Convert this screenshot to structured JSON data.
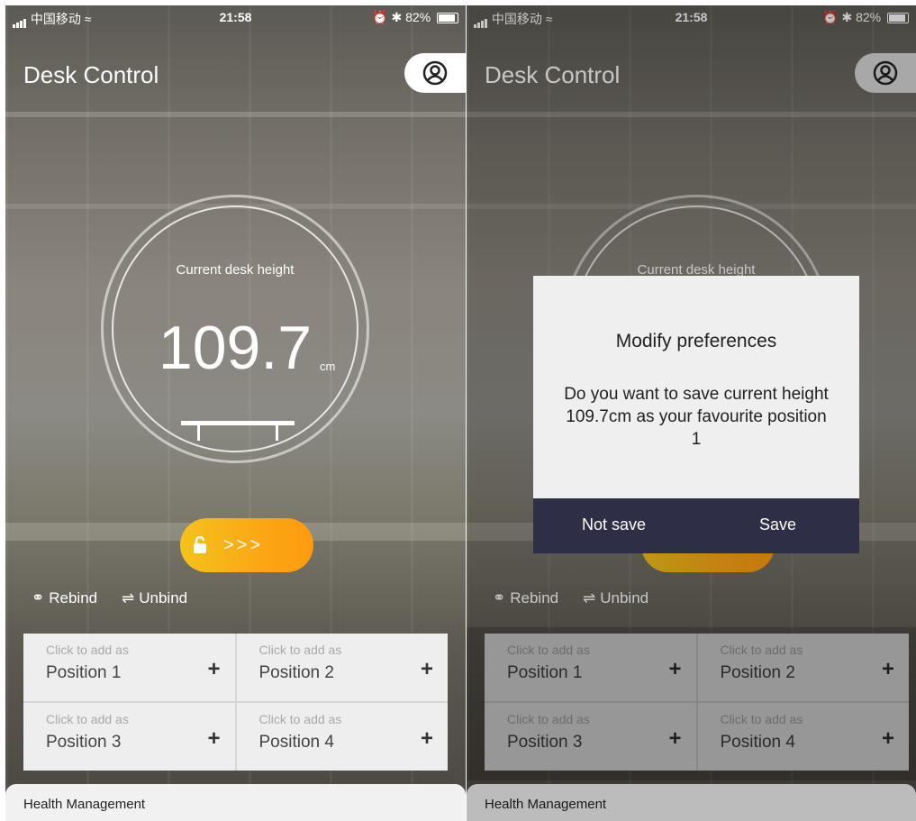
{
  "status": {
    "carrier": "中国移动",
    "time": "21:58",
    "battery": "82%"
  },
  "app": {
    "title": "Desk Control"
  },
  "gauge": {
    "label": "Current desk height",
    "value": "109.7",
    "unit": "cm"
  },
  "unlock": {
    "arrows": ">>>"
  },
  "binding": {
    "rebind": "Rebind",
    "unbind": "Unbind"
  },
  "positions": [
    {
      "hint": "Click to add as",
      "name": "Position 1",
      "plus": "+"
    },
    {
      "hint": "Click to add as",
      "name": "Position 2",
      "plus": "+"
    },
    {
      "hint": "Click to add as",
      "name": "Position 3",
      "plus": "+"
    },
    {
      "hint": "Click to add as",
      "name": "Position 4",
      "plus": "+"
    }
  ],
  "health": {
    "label": "Health Management"
  },
  "dialog": {
    "title": "Modify preferences",
    "message": "Do you want to save current height 109.7cm as your favourite position 1",
    "not_save": "Not save",
    "save": "Save"
  },
  "colors": {
    "accent_start": "#f4c21a",
    "accent_end": "#fe9b0e",
    "dialog_footer": "#2e2e46"
  }
}
